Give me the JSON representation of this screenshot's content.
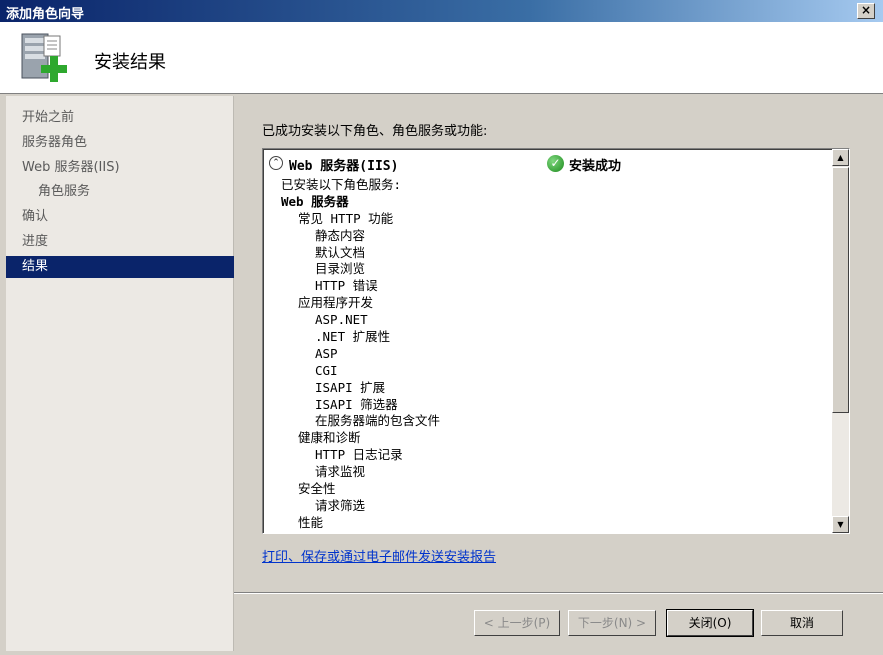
{
  "window": {
    "title": "添加角色向导",
    "close": "×"
  },
  "header": {
    "title": "安装结果"
  },
  "sidebar": {
    "items": [
      {
        "label": "开始之前",
        "level": 0,
        "active": false
      },
      {
        "label": "服务器角色",
        "level": 0,
        "active": false
      },
      {
        "label": "Web 服务器(IIS)",
        "level": 0,
        "active": false
      },
      {
        "label": "角色服务",
        "level": 1,
        "active": false
      },
      {
        "label": "确认",
        "level": 0,
        "active": false
      },
      {
        "label": "进度",
        "level": 0,
        "active": false
      },
      {
        "label": "结果",
        "level": 0,
        "active": true
      }
    ]
  },
  "main": {
    "intro": "已成功安装以下角色、角色服务或功能:",
    "result": {
      "role": "Web 服务器(IIS)",
      "status": "安装成功",
      "lines": [
        {
          "text": "已安装以下角色服务:",
          "cls": "lvl0"
        },
        {
          "text": "Web 服务器",
          "cls": "lvl0b"
        },
        {
          "text": "常见 HTTP 功能",
          "cls": "lvl1"
        },
        {
          "text": "静态内容",
          "cls": "lvl2"
        },
        {
          "text": "默认文档",
          "cls": "lvl2"
        },
        {
          "text": "目录浏览",
          "cls": "lvl2"
        },
        {
          "text": "HTTP 错误",
          "cls": "lvl2"
        },
        {
          "text": "应用程序开发",
          "cls": "lvl1"
        },
        {
          "text": "ASP.NET",
          "cls": "lvl2"
        },
        {
          "text": ".NET 扩展性",
          "cls": "lvl2"
        },
        {
          "text": "ASP",
          "cls": "lvl2"
        },
        {
          "text": "CGI",
          "cls": "lvl2"
        },
        {
          "text": "ISAPI 扩展",
          "cls": "lvl2"
        },
        {
          "text": "ISAPI 筛选器",
          "cls": "lvl2"
        },
        {
          "text": "在服务器端的包含文件",
          "cls": "lvl2"
        },
        {
          "text": "健康和诊断",
          "cls": "lvl1"
        },
        {
          "text": "HTTP 日志记录",
          "cls": "lvl2"
        },
        {
          "text": "请求监视",
          "cls": "lvl2"
        },
        {
          "text": "安全性",
          "cls": "lvl1"
        },
        {
          "text": "请求筛选",
          "cls": "lvl2"
        },
        {
          "text": "性能",
          "cls": "lvl1"
        }
      ]
    },
    "report_link": "打印、保存或通过电子邮件发送安装报告"
  },
  "buttons": {
    "prev": "< 上一步(P)",
    "next": "下一步(N) >",
    "close": "关闭(O)",
    "cancel": "取消"
  },
  "scrollbar": {
    "up": "▲",
    "down": "▼"
  },
  "icons": {
    "expand": "⌃",
    "success": "✓"
  }
}
